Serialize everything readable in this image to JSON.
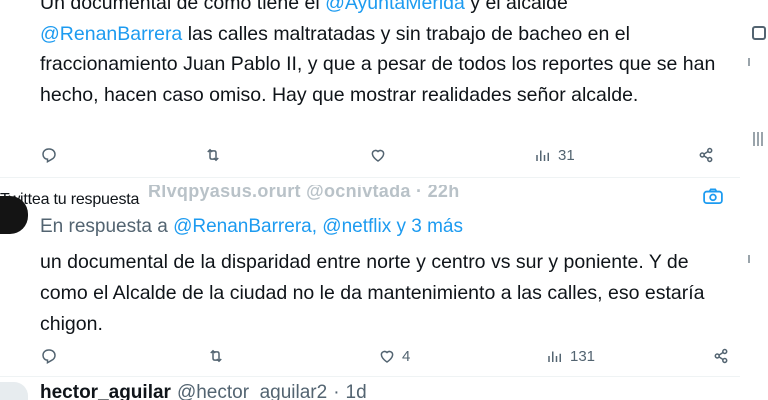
{
  "tweet1": {
    "line1_prefix": "Un documental de como tiene el ",
    "line1_mention": "@AyuntaMerida",
    "line1_suffix": " y el alcalde",
    "mention2": "@RenanBarrera",
    "text_rest": " las calles maltratadas y sin trabajo de bacheo en el fraccionamiento Juan Pablo II, y que a pesar de todos los reportes que se han hecho, hacen caso omiso. Hay que mostrar realidades señor alcalde.",
    "actions": {
      "reply_count": "",
      "retweet_count": "",
      "like_count": "",
      "views_count": "31"
    }
  },
  "reply_hint": "Twittea tu respuesta",
  "ghost_header": "Rlvqpyasus.orurt @ocnivtada · 22h",
  "tweet2": {
    "replying_prefix": "En respuesta a ",
    "replying_mentions": "@RenanBarrera, @netflix y 3 más",
    "text": "un documental de la disparidad entre norte y centro vs sur y poniente. Y de como el Alcalde de la ciudad no le da mantenimiento a las calles, eso estaría chigon.",
    "actions": {
      "reply_count": "",
      "retweet_count": "",
      "like_count": "4",
      "views_count": "131"
    }
  },
  "tweet3": {
    "name": "hector_aguilar",
    "handle": "@hector_aguilar2",
    "separator": "·",
    "time": "1d"
  },
  "icons": {
    "reply": "reply-icon",
    "retweet": "retweet-icon",
    "like": "heart-icon",
    "views": "views-icon",
    "share": "share-icon",
    "photo": "camera-icon"
  },
  "colors": {
    "text": "#0f1419",
    "secondary": "#536471",
    "accent": "#1d9bf0",
    "divider": "#eff3f4"
  }
}
